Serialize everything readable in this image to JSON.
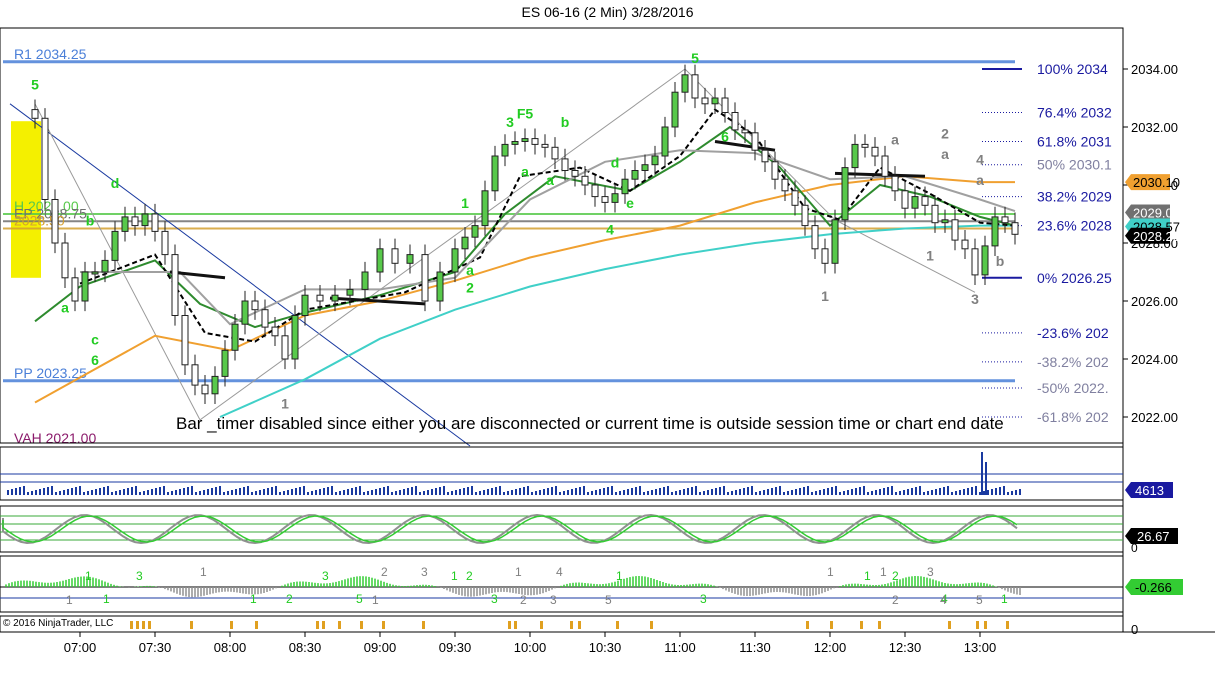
{
  "chart_title": "ES 06-16 (2 Min)  3/28/2016",
  "session_message": "Bar _timer disabled since either you are disconnected or current time is outside session time or chart end date",
  "copyright": "© 2016 NinjaTrader, LLC",
  "colors": {
    "price_up": "#58c94b",
    "price_down": "#1a1a1a",
    "ema_fast": "#2e8b2e",
    "ema_mid_dashed": "#000000",
    "ema_slow": "#f0a030",
    "ema_long": "#40d0c8",
    "gray_ma": "#a0a0a0",
    "pivot_blue": "#4a7fd8",
    "fib_text": "#1a1aa0",
    "wave_green": "#22cc22",
    "wave_gray": "#808080",
    "volume": "#1a3aa0"
  },
  "chart_data": [
    {
      "type": "candlestick",
      "title": "ES 06-16 (2 Min)  3/28/2016",
      "ylim": [
        2021.0,
        2035.5
      ],
      "y_ticks": [
        "2034.00",
        "2032.00",
        "2030.00",
        "2028.00",
        "2026.00",
        "2024.00",
        "2022.00"
      ],
      "x_ticks": [
        "07:00",
        "07:30",
        "08:00",
        "08:30",
        "09:00",
        "09:30",
        "10:00",
        "10:30",
        "11:00",
        "11:30",
        "12:00",
        "12:30",
        "13:00"
      ],
      "price_path": [
        [
          "06:42",
          2032.3
        ],
        [
          "06:46",
          2029.5
        ],
        [
          "06:50",
          2028.0
        ],
        [
          "06:54",
          2026.8
        ],
        [
          "06:58",
          2026.0
        ],
        [
          "07:02",
          2027.0
        ],
        [
          "07:06",
          2027.0
        ],
        [
          "07:10",
          2027.4
        ],
        [
          "07:14",
          2028.4
        ],
        [
          "07:18",
          2028.9
        ],
        [
          "07:22",
          2028.6
        ],
        [
          "07:26",
          2029.0
        ],
        [
          "07:30",
          2028.4
        ],
        [
          "07:34",
          2027.6
        ],
        [
          "07:38",
          2025.5
        ],
        [
          "07:42",
          2023.8
        ],
        [
          "07:46",
          2023.1
        ],
        [
          "07:50",
          2022.8
        ],
        [
          "07:54",
          2023.4
        ],
        [
          "07:58",
          2024.3
        ],
        [
          "08:02",
          2025.2
        ],
        [
          "08:06",
          2026.0
        ],
        [
          "08:10",
          2025.7
        ],
        [
          "08:14",
          2025.1
        ],
        [
          "08:18",
          2024.8
        ],
        [
          "08:22",
          2024.0
        ],
        [
          "08:26",
          2025.5
        ],
        [
          "08:30",
          2026.2
        ],
        [
          "08:36",
          2026.0
        ],
        [
          "08:42",
          2026.2
        ],
        [
          "08:48",
          2026.4
        ],
        [
          "08:54",
          2027.0
        ],
        [
          "09:00",
          2027.8
        ],
        [
          "09:06",
          2027.3
        ],
        [
          "09:12",
          2027.6
        ],
        [
          "09:18",
          2026.0
        ],
        [
          "09:24",
          2027.0
        ],
        [
          "09:30",
          2027.8
        ],
        [
          "09:34",
          2028.2
        ],
        [
          "09:38",
          2028.6
        ],
        [
          "09:42",
          2029.8
        ],
        [
          "09:46",
          2031.0
        ],
        [
          "09:50",
          2031.4
        ],
        [
          "09:54",
          2031.5
        ],
        [
          "09:58",
          2031.6
        ],
        [
          "10:02",
          2031.4
        ],
        [
          "10:06",
          2031.3
        ],
        [
          "10:10",
          2030.9
        ],
        [
          "10:14",
          2030.5
        ],
        [
          "10:18",
          2030.3
        ],
        [
          "10:22",
          2030.0
        ],
        [
          "10:26",
          2029.6
        ],
        [
          "10:30",
          2029.4
        ],
        [
          "10:34",
          2029.7
        ],
        [
          "10:38",
          2030.2
        ],
        [
          "10:42",
          2030.5
        ],
        [
          "10:46",
          2030.7
        ],
        [
          "10:50",
          2031.0
        ],
        [
          "10:54",
          2032.0
        ],
        [
          "10:58",
          2033.2
        ],
        [
          "11:02",
          2033.8
        ],
        [
          "11:06",
          2033.0
        ],
        [
          "11:10",
          2032.8
        ],
        [
          "11:14",
          2033.0
        ],
        [
          "11:18",
          2032.5
        ],
        [
          "11:22",
          2031.9
        ],
        [
          "11:26",
          2031.8
        ],
        [
          "11:30",
          2031.2
        ],
        [
          "11:34",
          2030.8
        ],
        [
          "11:38",
          2030.2
        ],
        [
          "11:42",
          2029.8
        ],
        [
          "11:46",
          2029.3
        ],
        [
          "11:50",
          2028.6
        ],
        [
          "11:54",
          2027.8
        ],
        [
          "11:58",
          2027.3
        ],
        [
          "12:02",
          2028.8
        ],
        [
          "12:06",
          2030.6
        ],
        [
          "12:10",
          2031.4
        ],
        [
          "12:14",
          2031.3
        ],
        [
          "12:18",
          2031.0
        ],
        [
          "12:22",
          2030.3
        ],
        [
          "12:26",
          2029.8
        ],
        [
          "12:30",
          2029.2
        ],
        [
          "12:34",
          2029.6
        ],
        [
          "12:38",
          2029.3
        ],
        [
          "12:42",
          2028.7
        ],
        [
          "12:46",
          2028.8
        ],
        [
          "12:50",
          2028.1
        ],
        [
          "12:54",
          2027.8
        ],
        [
          "12:58",
          2026.9
        ],
        [
          "13:02",
          2027.9
        ],
        [
          "13:06",
          2028.9
        ],
        [
          "13:10",
          2028.7
        ],
        [
          "13:14",
          2028.3
        ]
      ],
      "price_scale_labels": [
        {
          "value": 2030.1,
          "text": "2030.10",
          "bg": "#f0a030",
          "fg": "#000000"
        },
        {
          "value": 2029.05,
          "text": "2029.05",
          "bg": "#707070",
          "fg": "#ffffff"
        },
        {
          "value": 2028.57,
          "text": "2028.57",
          "bg": "#40d0c8",
          "fg": "#000000"
        },
        {
          "value": 2028.25,
          "text": "2028.25",
          "bg": "#000000",
          "fg": "#ffffff"
        }
      ],
      "levels": [
        {
          "label": "R1 2034.25",
          "value": 2034.25,
          "color": "#4a7fd8"
        },
        {
          "label": "PP 2023.25",
          "value": 2023.25,
          "color": "#4a7fd8"
        },
        {
          "label": "VAH 2021.00",
          "value": 2021.0,
          "color": "#8b1a6b"
        },
        {
          "label": "H 2029.00",
          "value": 2029.0,
          "color": "#58c94b"
        },
        {
          "label": "EP 2028.75",
          "value": 2028.75,
          "color": "#707070"
        },
        {
          "label": "2028.50",
          "value": 2028.5,
          "color": "#d4a030"
        }
      ],
      "fib_levels": [
        {
          "label": "100%  2034",
          "value": 2034.0
        },
        {
          "label": "76.4%  2032",
          "value": 2032.5
        },
        {
          "label": "61.8%  2031",
          "value": 2031.5
        },
        {
          "label": "50%  2030.1",
          "value": 2030.7,
          "muted": true
        },
        {
          "label": "38.2%  2029",
          "value": 2029.6
        },
        {
          "label": "23.6%  2028",
          "value": 2028.6
        },
        {
          "label": "0%  2026.25",
          "value": 2026.8
        },
        {
          "label": "-23.6%  202",
          "value": 2024.9
        },
        {
          "label": "-38.2%  202",
          "value": 2023.9,
          "muted": true
        },
        {
          "label": "-50%  2022.",
          "value": 2023.0,
          "muted": true
        },
        {
          "label": "-61.8%  202",
          "value": 2022.0,
          "muted": true
        }
      ],
      "wave_labels_green": [
        {
          "t": "06:42",
          "v": 2033.3,
          "label": "5"
        },
        {
          "t": "07:14",
          "v": 2029.9,
          "label": "d"
        },
        {
          "t": "07:04",
          "v": 2028.6,
          "label": "b"
        },
        {
          "t": "06:54",
          "v": 2025.6,
          "label": "a"
        },
        {
          "t": "07:06",
          "v": 2024.5,
          "label": "c"
        },
        {
          "t": "07:06",
          "v": 2023.8,
          "label": "6"
        },
        {
          "t": "09:34",
          "v": 2029.2,
          "label": "1"
        },
        {
          "t": "09:36",
          "v": 2026.9,
          "label": "a"
        },
        {
          "t": "09:36",
          "v": 2026.3,
          "label": "2"
        },
        {
          "t": "09:52",
          "v": 2032.0,
          "label": "3"
        },
        {
          "t": "09:58",
          "v": 2032.3,
          "label": "F5"
        },
        {
          "t": "10:14",
          "v": 2032.0,
          "label": "b"
        },
        {
          "t": "09:58",
          "v": 2030.3,
          "label": "a"
        },
        {
          "t": "10:08",
          "v": 2030.0,
          "label": "a"
        },
        {
          "t": "10:34",
          "v": 2030.6,
          "label": "d"
        },
        {
          "t": "10:40",
          "v": 2029.2,
          "label": "e"
        },
        {
          "t": "10:32",
          "v": 2028.3,
          "label": "4"
        },
        {
          "t": "11:06",
          "v": 2034.2,
          "label": "5"
        },
        {
          "t": "11:18",
          "v": 2031.5,
          "label": "6"
        }
      ],
      "wave_labels_gray": [
        {
          "t": "08:22",
          "v": 2022.3,
          "label": "1"
        },
        {
          "t": "11:58",
          "v": 2026.0,
          "label": "1"
        },
        {
          "t": "12:26",
          "v": 2031.4,
          "label": "a"
        },
        {
          "t": "12:46",
          "v": 2031.6,
          "label": "2"
        },
        {
          "t": "12:46",
          "v": 2030.9,
          "label": "a"
        },
        {
          "t": "13:00",
          "v": 2030.7,
          "label": "4"
        },
        {
          "t": "13:00",
          "v": 2030.0,
          "label": "a"
        },
        {
          "t": "12:40",
          "v": 2027.4,
          "label": "1"
        },
        {
          "t": "13:08",
          "v": 2027.2,
          "label": "b"
        },
        {
          "t": "12:58",
          "v": 2025.9,
          "label": "3"
        }
      ]
    },
    {
      "type": "bar",
      "panel": "volume",
      "value_label": "4613"
    },
    {
      "type": "line",
      "panel": "stochastics",
      "value_label": "26.67",
      "y_ticks": [
        "0"
      ]
    },
    {
      "type": "bar",
      "panel": "histogram-oscillator",
      "value_label": "-0.266",
      "wave_labels_green": [
        "1",
        "1",
        "3",
        "1",
        "3",
        "5",
        "1",
        "3",
        "1",
        "3",
        "1",
        "1",
        "2",
        "4",
        "2",
        "2"
      ],
      "wave_labels_gray": [
        "1",
        "2",
        "2",
        "4",
        "1",
        "3",
        "5",
        "1",
        "4",
        "3",
        "5",
        "1",
        "2",
        "1",
        "3",
        "1"
      ]
    },
    {
      "type": "bar",
      "panel": "marker-strip",
      "y_ticks": [
        "0"
      ]
    }
  ]
}
